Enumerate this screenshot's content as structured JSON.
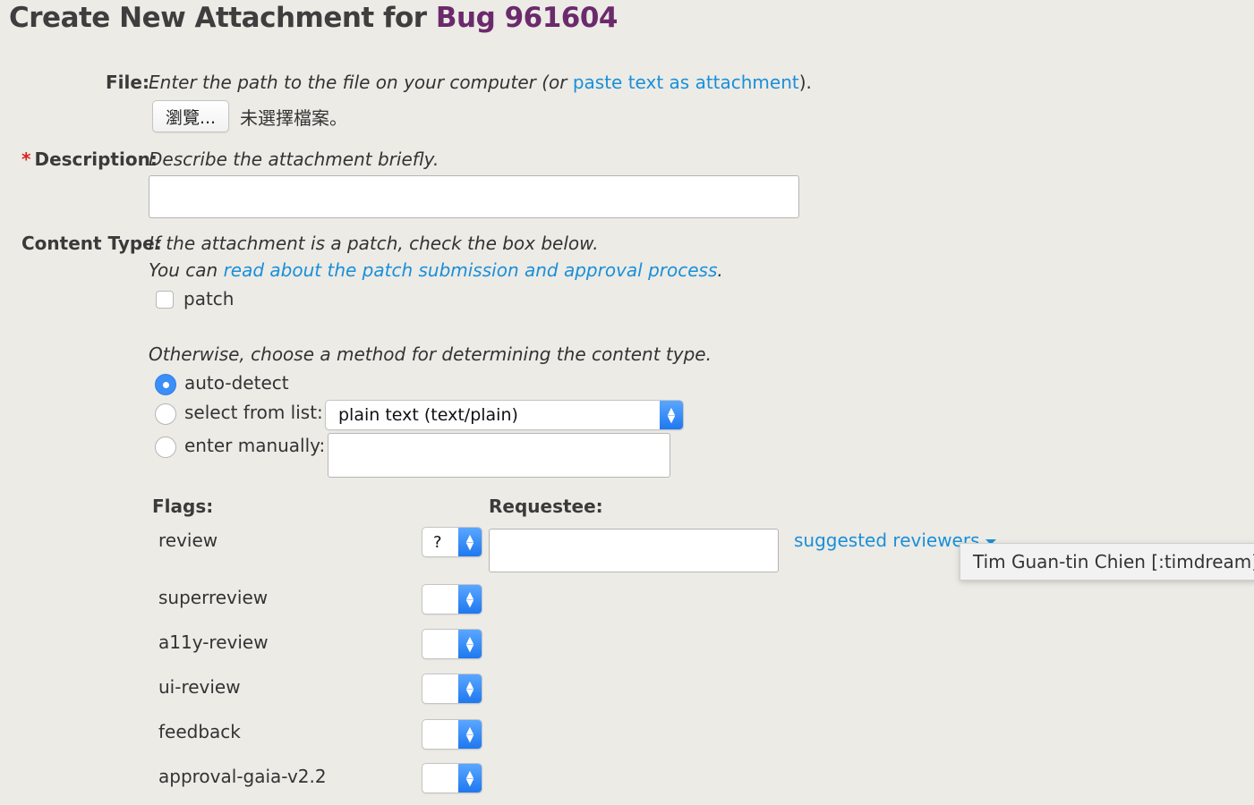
{
  "page": {
    "title_prefix": "Create New Attachment for ",
    "bug_link": "Bug 961604"
  },
  "file": {
    "label": "File:",
    "hint_prefix": "Enter the path to the file on your computer (or ",
    "paste_link": "paste text as attachment",
    "hint_suffix": ").",
    "browse_button": "瀏覽...",
    "no_file_text": "未選擇檔案。"
  },
  "description": {
    "required_marker": "*",
    "label": "Description:",
    "hint": "Describe the attachment briefly.",
    "value": ""
  },
  "content_type": {
    "label": "Content Type:",
    "hint_line1": "If the attachment is a patch, check the box below.",
    "hint_line2_prefix": "You can ",
    "process_link": "read about the patch submission and approval process",
    "hint_line2_suffix": ".",
    "patch_label": "patch",
    "patch_checked": false,
    "otherwise_hint": "Otherwise, choose a method for determining the content type.",
    "options": {
      "auto_detect": "auto-detect",
      "select_from_list": "select from list:",
      "enter_manually": "enter manually:"
    },
    "selected_method": "auto-detect",
    "list_value": "plain text (text/plain)",
    "manual_value": ""
  },
  "flags": {
    "flags_header": "Flags:",
    "requestee_header": "Requestee:",
    "suggested_link": "suggested reviewers",
    "suggested_tooltip": "Tim Guan-tin Chien [:timdream]",
    "items": [
      {
        "name": "review",
        "value": "?"
      },
      {
        "name": "superreview",
        "value": ""
      },
      {
        "name": "a11y-review",
        "value": ""
      },
      {
        "name": "ui-review",
        "value": ""
      },
      {
        "name": "feedback",
        "value": ""
      },
      {
        "name": "approval-gaia-v2.2",
        "value": ""
      }
    ],
    "requestee_value": ""
  }
}
